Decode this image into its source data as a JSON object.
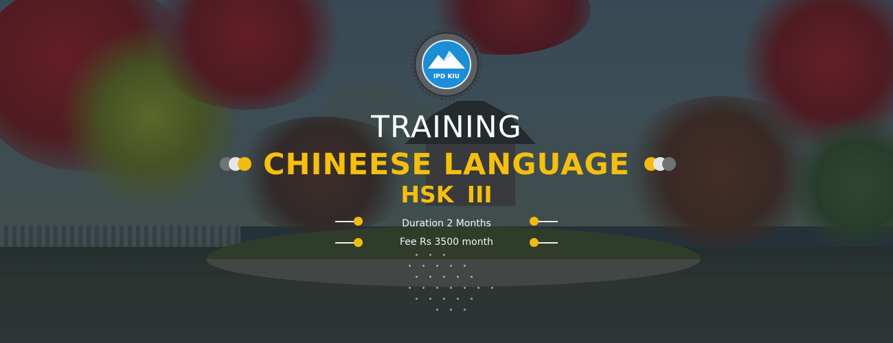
{
  "logo": {
    "text": "IPD KIU",
    "ring_text": "INSTITUTE OF PROFESSIONAL DEVELOPMENT KIU · GILGIT"
  },
  "heading": {
    "training": "TRAINING",
    "language": "CHINEESE LANGUAGE",
    "level": "HSK III"
  },
  "details": {
    "duration": "Duration 2 Months",
    "fee": "Fee Rs 3500 month"
  },
  "colors": {
    "accent": "#f5bf0f",
    "logo_blue": "#1b8ed6",
    "text_white": "#ffffff"
  },
  "decorations": {
    "left_circles_icon": "overlapping-circles-icon",
    "right_circles_icon": "overlapping-circles-icon",
    "line_bullet_icon": "line-dot-icon"
  }
}
